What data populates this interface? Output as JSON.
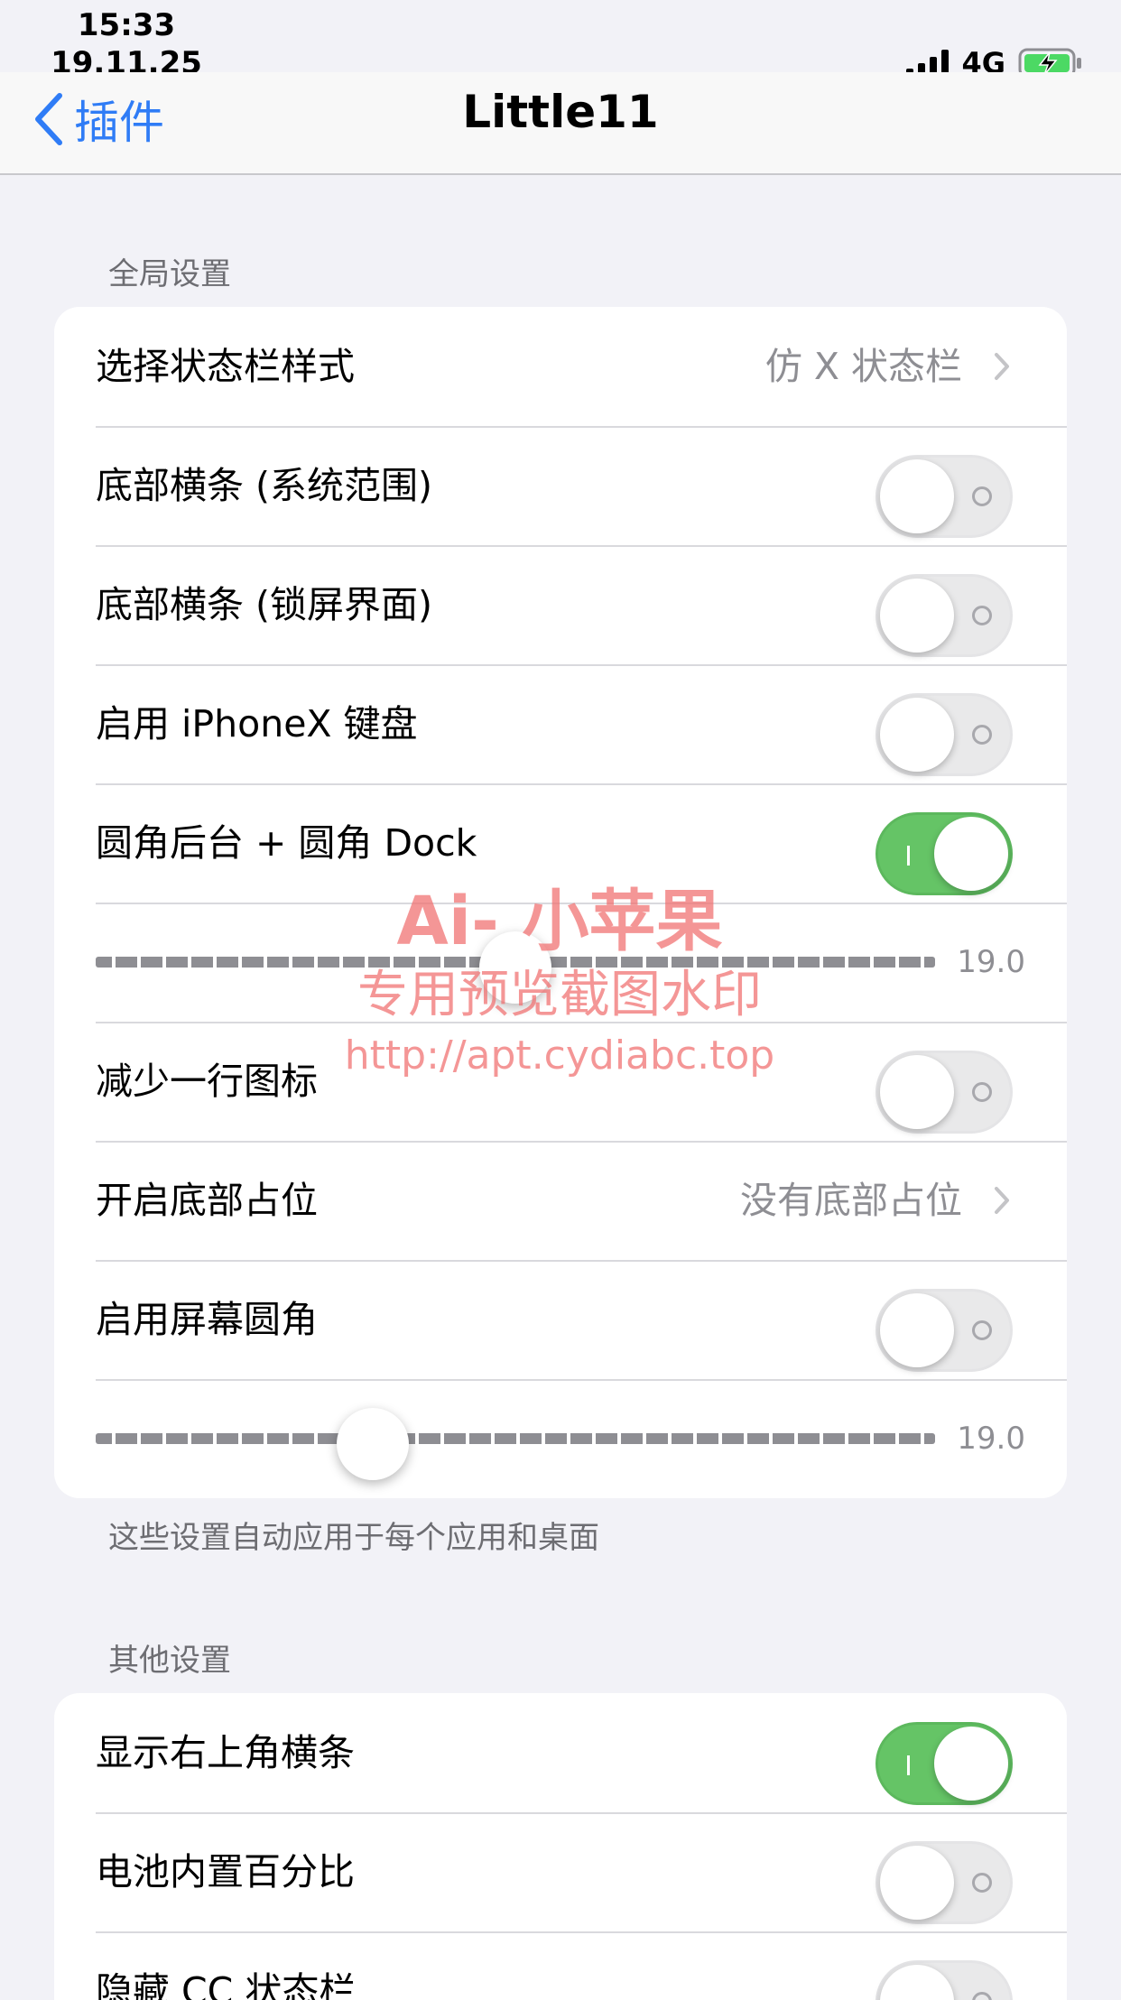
{
  "status_bar": {
    "time": "15:33",
    "date": "19.11.25",
    "network": "4G",
    "icons": [
      "signal-icon",
      "battery-charging-icon"
    ]
  },
  "nav": {
    "back_label": "插件",
    "title": "Little11"
  },
  "global_section": {
    "header": "全局设置",
    "footer": "这些设置自动应用于每个应用和桌面",
    "rows": [
      {
        "label": "选择状态栏样式",
        "value": "仿 X 状态栏"
      },
      {
        "label": "底部横条 (系统范围)",
        "on": false
      },
      {
        "label": "底部横条 (锁屏界面)",
        "on": false
      },
      {
        "label": "启用 iPhoneX 键盘",
        "on": false
      },
      {
        "label": "圆角后台 + 圆角 Dock",
        "on": true
      },
      {
        "slider_value": "19.0",
        "position": 0.5
      },
      {
        "label": "减少一行图标",
        "on": false
      },
      {
        "label": "开启底部占位",
        "value": "没有底部占位"
      },
      {
        "label": "启用屏幕圆角",
        "on": false
      },
      {
        "slider_value": "19.0",
        "position": 0.33
      }
    ]
  },
  "other_section": {
    "header": "其他设置",
    "rows": [
      {
        "label": "显示右上角横条",
        "on": true
      },
      {
        "label": "电池内置百分比",
        "on": false
      },
      {
        "label": "隐藏 CC 状态栏",
        "on": false
      }
    ]
  },
  "watermark": {
    "line1": "Ai- 小苹果",
    "line2": "专用预览截图水印",
    "line3": "http://apt.cydiabc.top"
  },
  "colors": {
    "accent": "#2f7cf6",
    "toggle_on": "#65c466",
    "toggle_off": "#e9e9ea",
    "background": "#f2f2f7",
    "watermark": "#f06e6e"
  }
}
